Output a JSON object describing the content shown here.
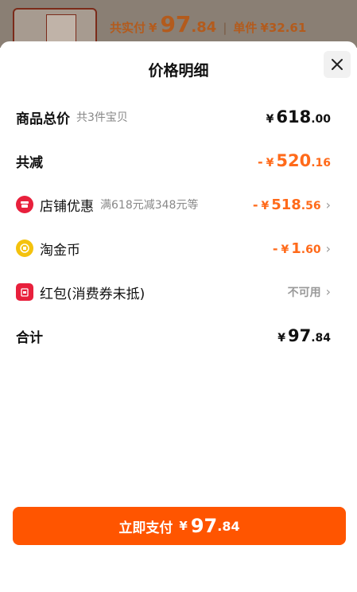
{
  "background": {
    "label_total": "共实付",
    "currency": "¥",
    "total_int": "97",
    "total_dec": ".84",
    "unit_label": "单件",
    "unit_price": "¥32.61"
  },
  "sheet": {
    "title": "价格明细",
    "rows": [
      {
        "label": "商品总价",
        "sub": "共3件宝贝",
        "currency": "¥",
        "int": "618",
        "dec": ".00"
      },
      {
        "label": "共减",
        "minus": "-",
        "currency": "¥",
        "int": "520",
        "dec": ".16"
      },
      {
        "label": "店铺优惠",
        "sub": "满618元减348元等",
        "minus": "-",
        "currency": "¥",
        "int": "518",
        "dec": ".56"
      },
      {
        "label": "淘金币",
        "minus": "-",
        "currency": "¥",
        "int": "1",
        "dec": ".60"
      },
      {
        "label": "红包(消费券未抵)",
        "status": "不可用"
      },
      {
        "label": "合计",
        "currency": "¥",
        "int": "97",
        "dec": ".84"
      }
    ],
    "pay_button": {
      "label": "立即支付",
      "currency": "¥",
      "int": "97",
      "dec": ".84"
    }
  },
  "colors": {
    "accent": "#ff5500",
    "discount": "#ff6a1a",
    "shop_icon": "#e8203c",
    "coin_icon": "#f4c20d",
    "redpacket_icon": "#e8203c"
  },
  "icons": [
    "close-icon",
    "shop-coupon-icon",
    "gold-coin-icon",
    "red-packet-icon",
    "chevron-right-icon"
  ]
}
